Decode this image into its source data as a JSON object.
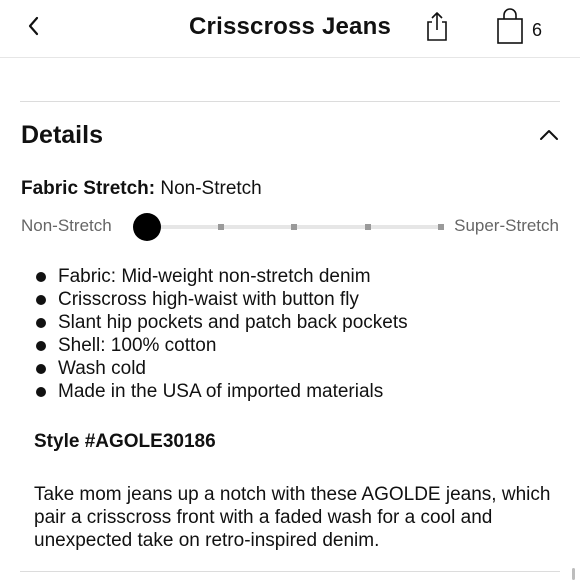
{
  "header": {
    "title": "Crisscross Jeans",
    "bag_count": "6",
    "back_icon": "chevron-left-icon",
    "share_icon": "share-icon",
    "bag_icon": "shopping-bag-icon"
  },
  "details": {
    "title": "Details",
    "collapse_icon": "chevron-up-icon",
    "fabric_stretch": {
      "label": "Fabric Stretch:",
      "value": "Non-Stretch",
      "scale_min": "Non-Stretch",
      "scale_max": "Super-Stretch",
      "level": 0,
      "steps": 5
    },
    "features": [
      "Fabric: Mid-weight non-stretch denim",
      "Crisscross high-waist with button fly",
      "Slant hip pockets and patch back pockets",
      "Shell: 100% cotton",
      "Wash cold",
      "Made in the USA of imported materials"
    ],
    "style_number": "Style #AGOLE30186",
    "description": "Take mom jeans up a notch with these AGOLDE jeans, which pair a crisscross front with a faded wash for a cool and unexpected take on retro-inspired denim."
  },
  "colors": {
    "text": "#111111",
    "muted": "#666666",
    "track": "#e6e6e6",
    "tick": "#9a9a9a",
    "divider": "#dcdcdc"
  }
}
